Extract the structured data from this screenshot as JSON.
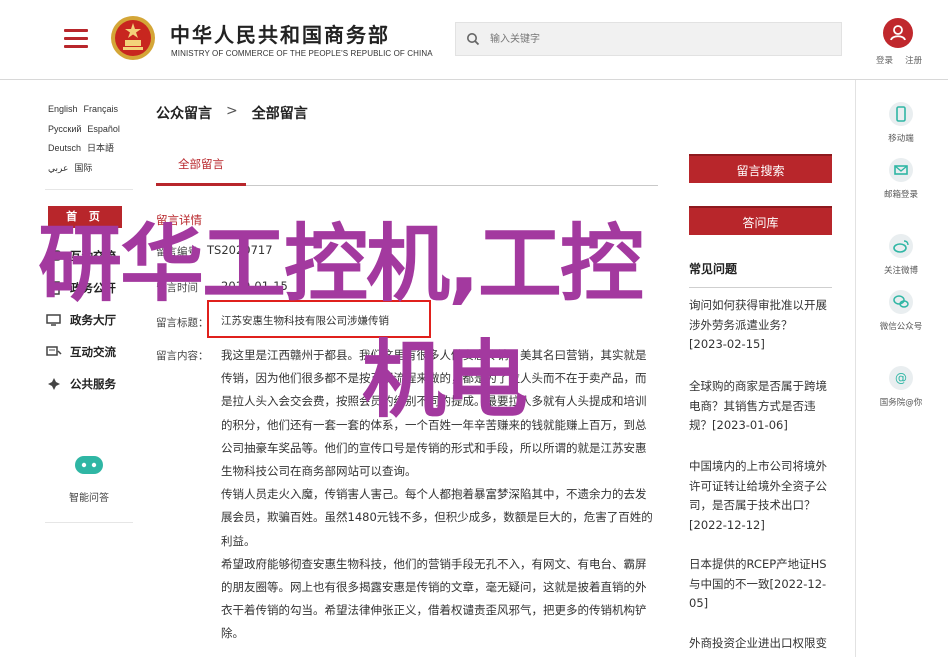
{
  "header": {
    "brand_cn": "中华人民共和国商务部",
    "brand_en": "MINISTRY OF COMMERCE OF THE PEOPLE'S REPUBLIC OF CHINA",
    "search_placeholder": "输入关键字",
    "login": "登录",
    "register": "注册",
    "accent": "#b8262b"
  },
  "languages": [
    [
      "English",
      "Français"
    ],
    [
      "Русский",
      "Español"
    ],
    [
      "Deutsch",
      "日本語"
    ],
    [
      "عربي",
      "国际"
    ]
  ],
  "left_nav": {
    "home": "首 页",
    "items": [
      {
        "label": "互动交流",
        "icon": "chat-icon"
      },
      {
        "label": "政务公开",
        "icon": "document-icon"
      },
      {
        "label": "政务大厅",
        "icon": "hall-icon"
      },
      {
        "label": "互动交流",
        "icon": "interact-icon"
      },
      {
        "label": "公共服务",
        "icon": "service-icon"
      }
    ],
    "zhineng": "智能问答"
  },
  "breadcrumb": {
    "root": "公众留言",
    "sep": ">",
    "current": "全部留言"
  },
  "tabs": {
    "active": "全部留言"
  },
  "detail": {
    "section_title": "留言详情",
    "row1_label": "留言编号",
    "row1_value": "TS2020717",
    "row2_label": "留言时间",
    "row2_value": "2019-01-15",
    "row3_label": "留言标题：",
    "row3_value": "江苏安惠生物科技有限公司涉嫌传销",
    "content_label": "留言内容：",
    "paragraphs": [
      "我这里是江西赣州于都县。我们这里有很多人做安惠传销，美其名曰营销，其实就是传销，因为他们很多都不是按正规流程来做的，都是为了拉人头而不在于卖产品，而是拉人头入会交会费，按照会员的级别不同的提成。最要拉人多就有人头提成和培训的积分，他们还有一套一套的体系，一个百姓一年辛苦赚来的钱就能赚上百万，到总公司抽豪车奖品等。他们的宣传口号是传销的形式和手段，所以所谓的就是江苏安惠生物科技公司在商务部网站可以查询。",
      "传销人员走火入魔，传销害人害己。每个人都抱着暴富梦深陷其中，不遗余力的去发展会员，欺骗百姓。虽然1480元钱不多，但积少成多，数额是巨大的，危害了百姓的利益。",
      "希望政府能够彻查安惠生物科技，他们的营销手段无孔不入，有网文、有电台、霸屏的朋友圈等。网上也有很多揭露安惠是传销的文章，毫无疑问，这就是披着直销的外衣干着传销的勾当。希望法律伸张正义，借着权谴责歪风邪气，把更多的传销机构铲除。"
    ]
  },
  "right": {
    "search_btn": "留言搜索",
    "faq_btn": "答问库",
    "faq_title": "常见问题",
    "news": [
      {
        "text": "询问如何获得审批准以开展涉外劳务派遣业务？",
        "date": "2023-02-15"
      },
      {
        "text": "全球购的商家是否属于跨境电商？其销售方式是否违规？",
        "date": "2023-01-06"
      },
      {
        "text": "中国境内的上市公司将境外许可证转让给境外全资子公司，是否属于技术出口？",
        "date": "2022-12-12"
      },
      {
        "text": "日本提供的RCEP产地证HS与中国的不一致",
        "date": "2022-12-05"
      },
      {
        "text": "外商投资企业进出口权限变",
        "date": ""
      }
    ]
  },
  "share": [
    {
      "label": "移动端",
      "icon": "mobile-icon"
    },
    {
      "label": "邮箱登录",
      "icon": "mail-icon"
    },
    {
      "label": "关注微博",
      "icon": "weibo-icon"
    },
    {
      "label": "微信公众号",
      "icon": "wechat-icon"
    },
    {
      "label": "国务院@你",
      "icon": "at-icon"
    }
  ],
  "watermark": {
    "line1": "研华工控机,工控",
    "line2": "机电",
    "color": "#a3399f"
  }
}
